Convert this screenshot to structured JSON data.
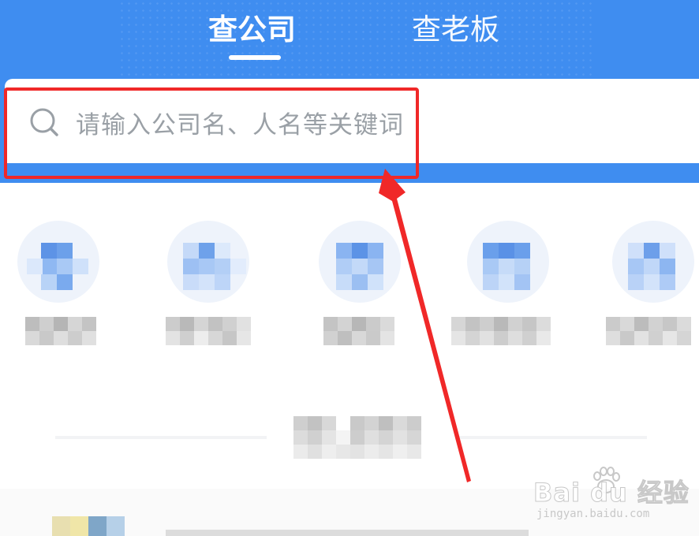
{
  "header": {
    "tabs": [
      {
        "label": "查公司",
        "active": true
      },
      {
        "label": "查老板",
        "active": false
      }
    ]
  },
  "search": {
    "placeholder": "请输入公司名、人名等关键词"
  },
  "categories_note": "blurred",
  "watermark": {
    "brand_main": "Bai du 经验",
    "brand_sub": "jingyan.baidu.com"
  },
  "colors": {
    "primary_blue": "#3f8df0",
    "annotation_red": "#f02828",
    "placeholder_gray": "#9aa0a6"
  }
}
